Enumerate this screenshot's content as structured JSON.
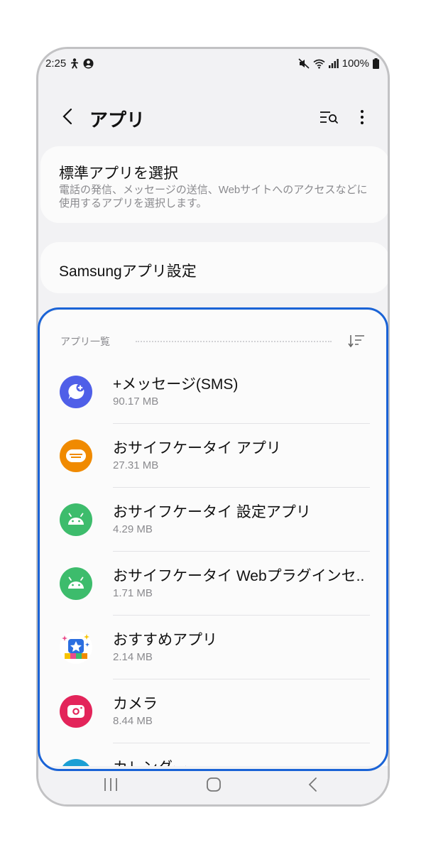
{
  "status_bar": {
    "time": "2:25",
    "battery": "100%"
  },
  "header": {
    "title": "アプリ",
    "icons": [
      "back-arrow-icon",
      "search-list-icon",
      "more-vertical-icon"
    ]
  },
  "default_apps": {
    "title": "標準アプリを選択",
    "description": "電話の発信、メッセージの送信、Webサイトへのアクセスなどに使用するアプリを選択します。"
  },
  "samsung_settings": {
    "title": "Samsungアプリ設定"
  },
  "app_list": {
    "header": "アプリ一覧",
    "items": [
      {
        "name": "+メッセージ(SMS)",
        "size": "90.17 MB",
        "icon": "plus-message-icon",
        "color": "#4f5fe8"
      },
      {
        "name": "おサイフケータイ アプリ",
        "size": "27.31 MB",
        "icon": "osaifu-keitai-icon",
        "color": "#f08a00"
      },
      {
        "name": "おサイフケータイ 設定アプリ",
        "size": "4.29 MB",
        "icon": "android-icon",
        "color": "#3dbc6c"
      },
      {
        "name": "おサイフケータイ Webプラグインセ..",
        "size": "1.71 MB",
        "icon": "android-icon",
        "color": "#3dbc6c"
      },
      {
        "name": "おすすめアプリ",
        "size": "2.14 MB",
        "icon": "recommended-apps-icon",
        "color": "#2a6ee0"
      },
      {
        "name": "カメラ",
        "size": "8.44 MB",
        "icon": "camera-icon",
        "color": "#e3245a"
      },
      {
        "name": "カレンダー",
        "size": "",
        "icon": "calendar-icon",
        "color": "#1b9fd4"
      }
    ]
  },
  "colors": {
    "highlight": "#1a63d6",
    "background": "#f2f2f4",
    "card": "#fbfbfb"
  }
}
